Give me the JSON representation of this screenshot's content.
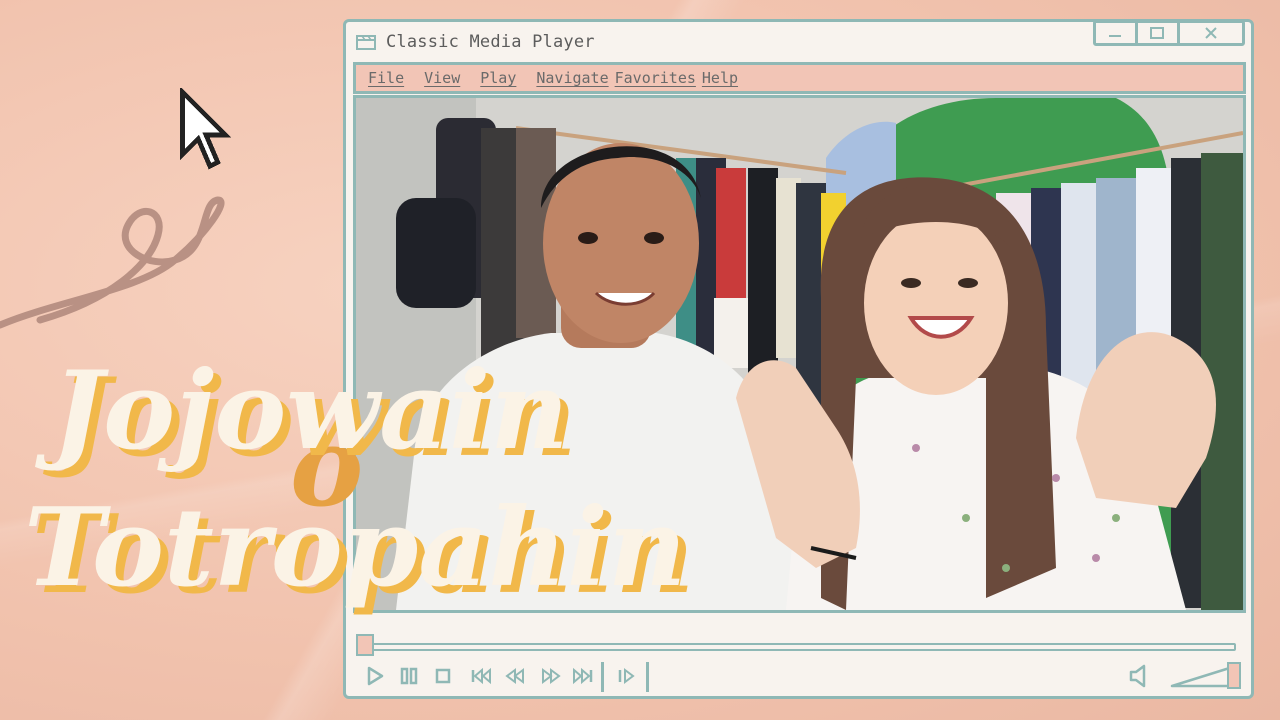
{
  "window": {
    "title": "Classic Media Player"
  },
  "menu": [
    {
      "label": "File"
    },
    {
      "label": "View"
    },
    {
      "label": "Play"
    },
    {
      "label": "Navigate"
    },
    {
      "label": "Favorites"
    },
    {
      "label": "Help"
    }
  ],
  "overlay": {
    "line1": "Jojowain",
    "connector": "o",
    "line2": "Totropahin"
  },
  "player": {
    "progress": 0
  },
  "colors": {
    "background": "#f1c2ad",
    "frame": "#8fb8b5",
    "menubar": "#f2c5b6",
    "title_fill": "#fbf3e6",
    "title_shadow": "#f1b84a",
    "connector": "#e6a143"
  },
  "icons": [
    "window-icon",
    "minimize-icon",
    "maximize-icon",
    "close-icon",
    "play-icon",
    "pause-icon",
    "stop-icon",
    "skip-back-icon",
    "rewind-icon",
    "fast-forward-icon",
    "skip-forward-icon",
    "frame-step-icon",
    "volume-icon",
    "volume-slider-icon",
    "cursor-icon"
  ]
}
